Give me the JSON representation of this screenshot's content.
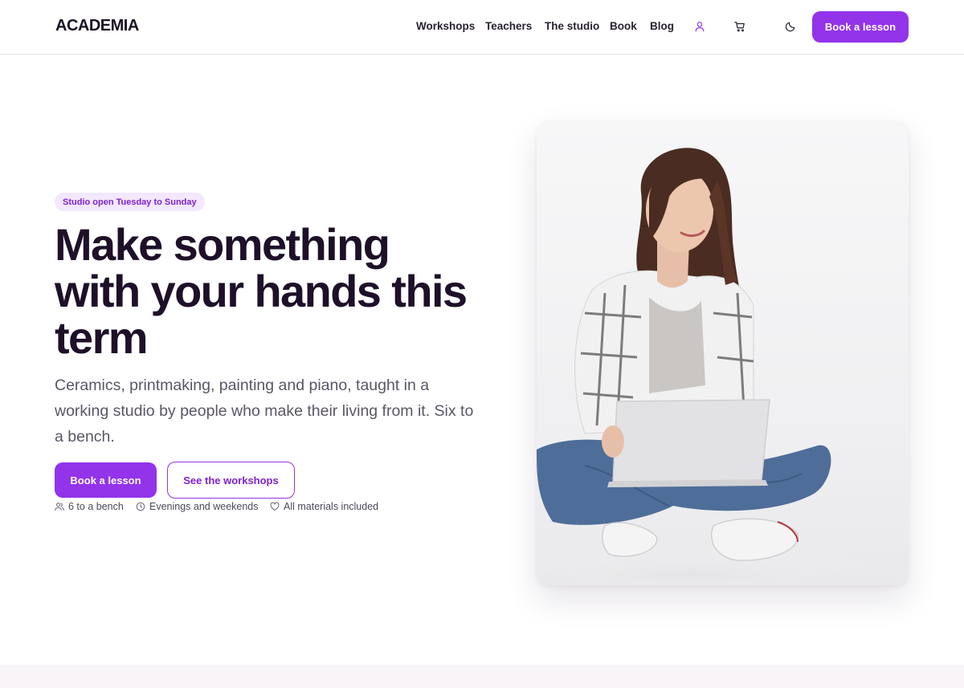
{
  "brand": {
    "name": "ACADEMIA",
    "accent": "#9333ea"
  },
  "nav": {
    "items": [
      "Workshops",
      "Teachers",
      "The studio",
      "Book",
      "Blog"
    ],
    "icons": [
      "user-icon",
      "cart-icon",
      "moon-icon"
    ],
    "cta_label": "Book a lesson"
  },
  "hero": {
    "badge": "Studio open Tuesday to Sunday",
    "headline_lines": [
      "Make something",
      "with your hands this",
      "term"
    ],
    "subcopy_lines": [
      "Ceramics, printmaking, painting and piano, taught in a",
      "working studio by people who make their living from it. Six to",
      "a bench."
    ],
    "primary_button": "Book a lesson",
    "secondary_button": "See the workshops",
    "features": [
      {
        "icon": "users-icon",
        "label": "6 to a bench"
      },
      {
        "icon": "clock-icon",
        "label": "Evenings and weekends"
      },
      {
        "icon": "heart-icon",
        "label": "All materials included"
      }
    ]
  }
}
